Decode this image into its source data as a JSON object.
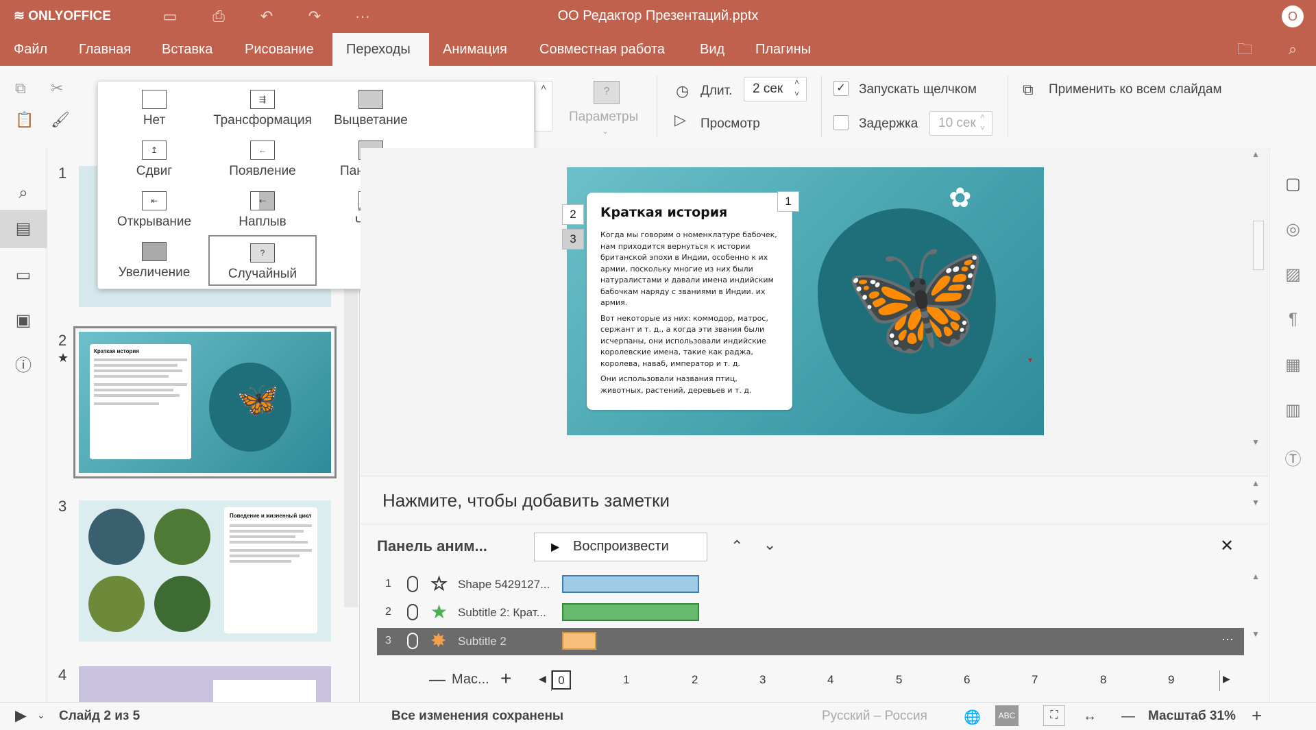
{
  "app": {
    "brand": "ONLYOFFICE",
    "title": "ОО Редактор Презентаций.pptx",
    "user_initial": "О",
    "accent": "#c0614d"
  },
  "menu_tabs": [
    "Файл",
    "Главная",
    "Вставка",
    "Рисование",
    "Переходы",
    "Анимация",
    "Совместная работа",
    "Вид",
    "Плагины"
  ],
  "active_tab": "Переходы",
  "toolbar": {
    "params_label": "Параметры",
    "duration_label": "Длит.",
    "duration_value": "2 сек",
    "preview_label": "Просмотр",
    "start_on_click_label": "Запускать щелчком",
    "start_on_click_checked": true,
    "delay_label": "Задержка",
    "delay_value": "10 сек",
    "delay_checked": false,
    "apply_all_label": "Применить ко всем слайдам"
  },
  "transitions": [
    {
      "label": "Нет",
      "icon": "none-icon"
    },
    {
      "label": "Трансформация",
      "icon": "morph-icon"
    },
    {
      "label": "Выцветание",
      "icon": "fade-icon"
    },
    {
      "label": "Сдвиг",
      "icon": "push-icon"
    },
    {
      "label": "Появление",
      "icon": "wipe-icon"
    },
    {
      "label": "Панорама",
      "icon": "split-icon"
    },
    {
      "label": "Открывание",
      "icon": "uncover-icon"
    },
    {
      "label": "Наплыв",
      "icon": "cover-icon"
    },
    {
      "label": "Часы",
      "icon": "clock-icon"
    },
    {
      "label": "Увеличение",
      "icon": "zoom-icon"
    },
    {
      "label": "Случайный",
      "icon": "random-icon",
      "selected": true
    }
  ],
  "slides": {
    "numbers": [
      "1",
      "2",
      "3",
      "4"
    ],
    "thumb2": {
      "title": "Краткая история"
    },
    "thumb3": {
      "title": "Поведение и жизненный цикл"
    }
  },
  "slide": {
    "title": "Краткая история",
    "para1": "Когда мы говорим о номенклатуре бабочек, нам приходится вернуться к истории британской эпохи в Индии, особенно к их армии, поскольку многие из них были натуралистами и давали имена индийским бабочкам наряду с званиями в Индии. их армия.",
    "para2": "Вот некоторые из них: коммодор, матрос, сержант и т. д., а когда эти звания были исчерпаны, они использовали индийские королевские имена, такие как раджа, королева, наваб, император и т. д.",
    "para3": "Они использовали названия птиц, животных, растений, деревьев и т. д.",
    "tags": [
      "1",
      "2",
      "3"
    ]
  },
  "notes_placeholder": "Нажмите, чтобы добавить заметки",
  "anim_pane": {
    "title": "Панель аним...",
    "play_label": "Воспроизвести",
    "rows": [
      {
        "num": "1",
        "name": "Shape 5429127...",
        "color": "#9fcbe6",
        "border": "#3a7fb5",
        "start": 0,
        "end": 2
      },
      {
        "num": "2",
        "name": "Subtitle 2: Крат...",
        "color": "#67b96d",
        "border": "#2f8a3a",
        "start": 0,
        "end": 2
      },
      {
        "num": "3",
        "name": "Subtitle 2",
        "color": "#f6bf7a",
        "border": "#d7943f",
        "start": 0,
        "end": 0.5
      }
    ],
    "scale_label": "Мас...",
    "timeline_ticks": [
      "0",
      "1",
      "2",
      "3",
      "4",
      "5",
      "6",
      "7",
      "8",
      "9"
    ]
  },
  "status": {
    "slide_counter": "Слайд 2 из 5",
    "save_status": "Все изменения сохранены",
    "language": "Русский – Россия",
    "zoom": "Масштаб 31%"
  }
}
